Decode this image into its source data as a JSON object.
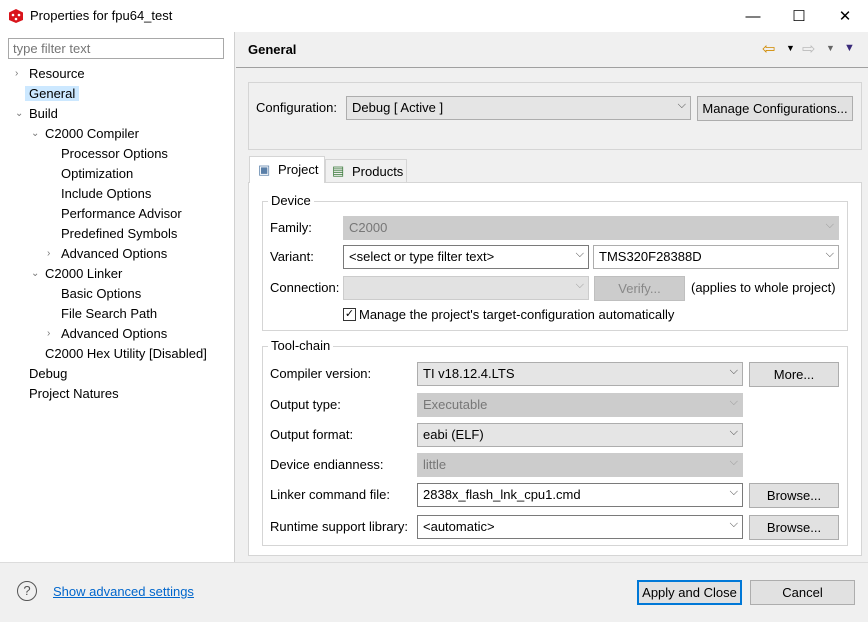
{
  "window": {
    "title": "Properties for fpu64_test",
    "minimize": "—",
    "maximize": "☐",
    "close": "✕"
  },
  "sidebar": {
    "filter_placeholder": "type filter text",
    "items": [
      {
        "label": "Resource",
        "level": 0,
        "twisty": "›"
      },
      {
        "label": "General",
        "level": 0,
        "selected": true
      },
      {
        "label": "Build",
        "level": 0,
        "twisty": "⌄"
      },
      {
        "label": "C2000 Compiler",
        "level": 1,
        "twisty": "⌄"
      },
      {
        "label": "Processor Options",
        "level": 2
      },
      {
        "label": "Optimization",
        "level": 2
      },
      {
        "label": "Include Options",
        "level": 2
      },
      {
        "label": "Performance Advisor",
        "level": 2
      },
      {
        "label": "Predefined Symbols",
        "level": 2
      },
      {
        "label": "Advanced Options",
        "level": 2,
        "twisty": "›"
      },
      {
        "label": "C2000 Linker",
        "level": 1,
        "twisty": "⌄"
      },
      {
        "label": "Basic Options",
        "level": 2
      },
      {
        "label": "File Search Path",
        "level": 2
      },
      {
        "label": "Advanced Options",
        "level": 2,
        "twisty": "›"
      },
      {
        "label": "C2000 Hex Utility  [Disabled]",
        "level": 1
      },
      {
        "label": "Debug",
        "level": 0
      },
      {
        "label": "Project Natures",
        "level": 0
      }
    ]
  },
  "header": {
    "title": "General"
  },
  "config": {
    "label": "Configuration:",
    "value": "Debug  [ Active ]",
    "manage_button": "Manage Configurations..."
  },
  "tabs": [
    {
      "label": "Project",
      "active": true
    },
    {
      "label": "Products"
    }
  ],
  "device": {
    "legend": "Device",
    "family_label": "Family:",
    "family_value": "C2000",
    "variant_label": "Variant:",
    "variant_filter": "<select or type filter text>",
    "variant_value": "TMS320F28388D",
    "connection_label": "Connection:",
    "connection_value": "",
    "verify_button": "Verify...",
    "applies_note": "(applies to whole project)",
    "manage_checkbox": "Manage the project's target-configuration automatically",
    "manage_checked": true
  },
  "toolchain": {
    "legend": "Tool-chain",
    "compiler_label": "Compiler version:",
    "compiler_value": "TI v18.12.4.LTS",
    "more_button": "More...",
    "output_type_label": "Output type:",
    "output_type_value": "Executable",
    "output_format_label": "Output format:",
    "output_format_value": "eabi (ELF)",
    "endianness_label": "Device endianness:",
    "endianness_value": "little",
    "linker_label": "Linker command file:",
    "linker_value": "2838x_flash_lnk_cpu1.cmd",
    "browse_button": "Browse...",
    "runtime_label": "Runtime support library:",
    "runtime_value": "<automatic>",
    "browse_button2": "Browse..."
  },
  "footer": {
    "help": "?",
    "advanced_link": "Show advanced settings",
    "apply_close": "Apply and Close",
    "cancel": "Cancel"
  },
  "colors": {
    "selection": "#cce8ff",
    "link": "#0066cc",
    "default_border": "#0078d7"
  }
}
